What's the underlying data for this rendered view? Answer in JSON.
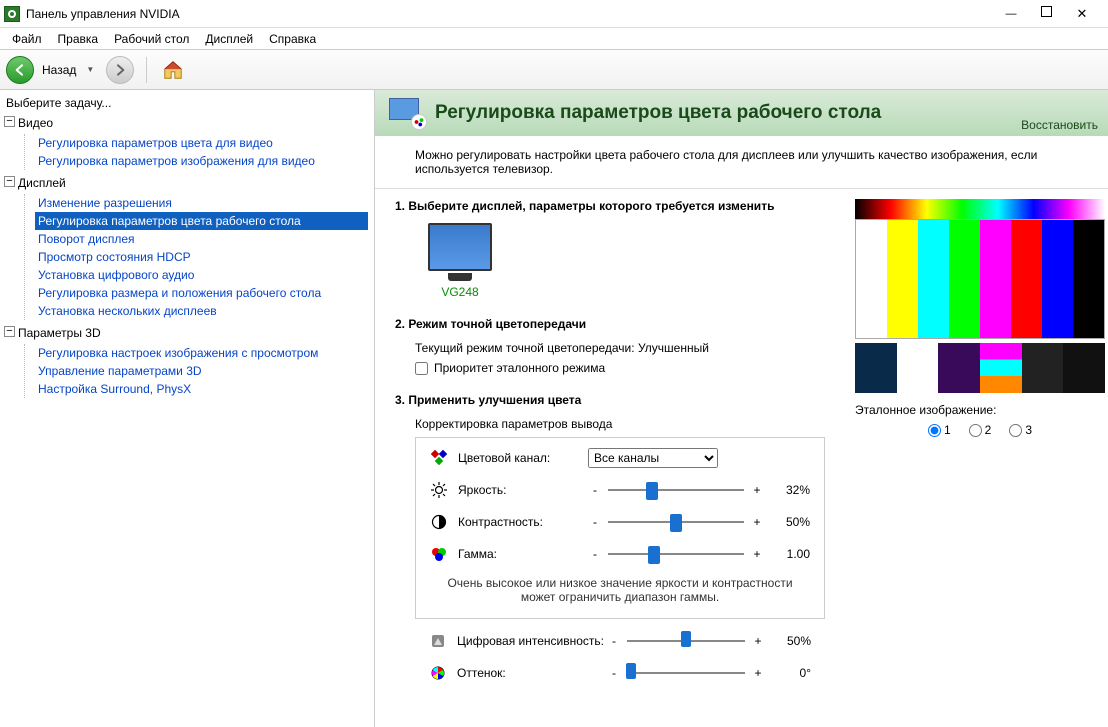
{
  "titlebar": {
    "title": "Панель управления NVIDIA"
  },
  "menubar": {
    "file": "Файл",
    "edit": "Правка",
    "desktop": "Рабочий стол",
    "display": "Дисплей",
    "help": "Справка"
  },
  "toolbar": {
    "back_label": "Назад"
  },
  "sidebar": {
    "task_prompt": "Выберите задачу...",
    "groups": [
      {
        "label": "Видео",
        "items": [
          "Регулировка параметров цвета для видео",
          "Регулировка параметров изображения для видео"
        ]
      },
      {
        "label": "Дисплей",
        "items": [
          "Изменение разрешения",
          "Регулировка параметров цвета рабочего стола",
          "Поворот дисплея",
          "Просмотр состояния HDCP",
          "Установка цифрового аудио",
          "Регулировка размера и положения рабочего стола",
          "Установка нескольких дисплеев"
        ],
        "selected_index": 1
      },
      {
        "label": "Параметры 3D",
        "items": [
          "Регулировка настроек изображения с просмотром",
          "Управление параметрами 3D",
          "Настройка Surround, PhysX"
        ]
      }
    ]
  },
  "page": {
    "title": "Регулировка параметров цвета рабочего стола",
    "restore": "Восстановить",
    "description": "Можно регулировать настройки цвета рабочего стола для дисплеев или улучшить качество изображения, если используется телевизор."
  },
  "step1": {
    "title": "1. Выберите дисплей, параметры которого требуется изменить",
    "monitor_name": "VG248"
  },
  "step2": {
    "title": "2. Режим точной цветопередачи",
    "current_mode_label": "Текущий режим точной цветопередачи:",
    "current_mode_value": "Улучшенный",
    "checkbox_label": "Приоритет эталонного режима"
  },
  "step3": {
    "title": "3. Применить улучшения цвета",
    "panel_label": "Корректировка параметров вывода",
    "channel": {
      "label": "Цветовой канал:",
      "value": "Все каналы"
    },
    "brightness": {
      "label": "Яркость:",
      "value": "32%",
      "pos": 32
    },
    "contrast": {
      "label": "Контрастность:",
      "value": "50%",
      "pos": 50
    },
    "gamma": {
      "label": "Гамма:",
      "value": "1.00",
      "pos": 34
    },
    "note": "Очень высокое или низкое значение яркости и контрастности может ограничить диапазон гаммы.",
    "vibrance": {
      "label": "Цифровая интенсивность:",
      "value": "50%",
      "pos": 50
    },
    "hue": {
      "label": "Оттенок:",
      "value": "0°",
      "pos": 3
    }
  },
  "preview": {
    "ref_label": "Эталонное изображение:",
    "opts": [
      "1",
      "2",
      "3"
    ],
    "selected": 0
  },
  "glyphs": {
    "minus": "-",
    "plus": "+",
    "toggle_minus": "−"
  }
}
